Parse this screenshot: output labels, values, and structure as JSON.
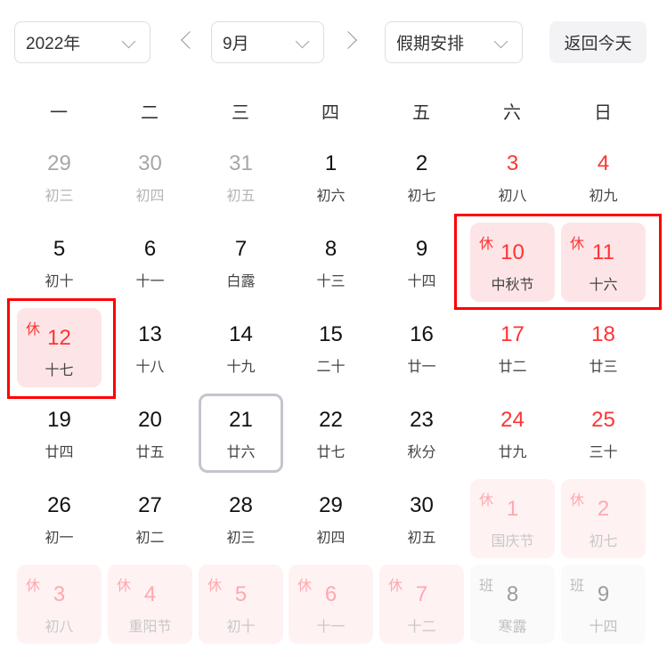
{
  "toolbar": {
    "year_select": "2022年",
    "month_select": "9月",
    "holiday_select": "假期安排",
    "today_button": "返回今天"
  },
  "weekdays": [
    "一",
    "二",
    "三",
    "四",
    "五",
    "六",
    "日"
  ],
  "colors": {
    "accent_red": "#ff3333",
    "rest_bg": "#fde5e7",
    "highlight_outline": "#ff0000",
    "today_border": "#c3c5ce"
  },
  "days": [
    {
      "day": "29",
      "lunar": "初三",
      "type": "other"
    },
    {
      "day": "30",
      "lunar": "初四",
      "type": "other"
    },
    {
      "day": "31",
      "lunar": "初五",
      "type": "other"
    },
    {
      "day": "1",
      "lunar": "初六",
      "type": "normal"
    },
    {
      "day": "2",
      "lunar": "初七",
      "type": "normal"
    },
    {
      "day": "3",
      "lunar": "初八",
      "type": "weekend"
    },
    {
      "day": "4",
      "lunar": "初九",
      "type": "weekend"
    },
    {
      "day": "5",
      "lunar": "初十",
      "type": "normal"
    },
    {
      "day": "6",
      "lunar": "十一",
      "type": "normal"
    },
    {
      "day": "7",
      "lunar": "白露",
      "type": "normal"
    },
    {
      "day": "8",
      "lunar": "十三",
      "type": "normal"
    },
    {
      "day": "9",
      "lunar": "十四",
      "type": "normal"
    },
    {
      "day": "10",
      "lunar": "中秋节",
      "type": "rest",
      "tag": "休"
    },
    {
      "day": "11",
      "lunar": "十六",
      "type": "rest",
      "tag": "休"
    },
    {
      "day": "12",
      "lunar": "十七",
      "type": "rest",
      "tag": "休"
    },
    {
      "day": "13",
      "lunar": "十八",
      "type": "normal"
    },
    {
      "day": "14",
      "lunar": "十九",
      "type": "normal"
    },
    {
      "day": "15",
      "lunar": "二十",
      "type": "normal"
    },
    {
      "day": "16",
      "lunar": "廿一",
      "type": "normal"
    },
    {
      "day": "17",
      "lunar": "廿二",
      "type": "weekend"
    },
    {
      "day": "18",
      "lunar": "廿三",
      "type": "weekend"
    },
    {
      "day": "19",
      "lunar": "廿四",
      "type": "normal"
    },
    {
      "day": "20",
      "lunar": "廿五",
      "type": "normal"
    },
    {
      "day": "21",
      "lunar": "廿六",
      "type": "today"
    },
    {
      "day": "22",
      "lunar": "廿七",
      "type": "normal"
    },
    {
      "day": "23",
      "lunar": "秋分",
      "type": "normal"
    },
    {
      "day": "24",
      "lunar": "廿九",
      "type": "weekend"
    },
    {
      "day": "25",
      "lunar": "三十",
      "type": "weekend"
    },
    {
      "day": "26",
      "lunar": "初一",
      "type": "normal"
    },
    {
      "day": "27",
      "lunar": "初二",
      "type": "normal"
    },
    {
      "day": "28",
      "lunar": "初三",
      "type": "normal"
    },
    {
      "day": "29",
      "lunar": "初四",
      "type": "normal"
    },
    {
      "day": "30",
      "lunar": "初五",
      "type": "normal"
    },
    {
      "day": "1",
      "lunar": "国庆节",
      "type": "rest-other",
      "tag": "休"
    },
    {
      "day": "2",
      "lunar": "初七",
      "type": "rest-other",
      "tag": "休"
    },
    {
      "day": "3",
      "lunar": "初八",
      "type": "rest-other",
      "tag": "休"
    },
    {
      "day": "4",
      "lunar": "重阳节",
      "type": "rest-other",
      "tag": "休"
    },
    {
      "day": "5",
      "lunar": "初十",
      "type": "rest-other",
      "tag": "休"
    },
    {
      "day": "6",
      "lunar": "十一",
      "type": "rest-other",
      "tag": "休"
    },
    {
      "day": "7",
      "lunar": "十二",
      "type": "rest-other",
      "tag": "休"
    },
    {
      "day": "8",
      "lunar": "寒露",
      "type": "work-other",
      "tag": "班"
    },
    {
      "day": "9",
      "lunar": "十四",
      "type": "work-other",
      "tag": "班"
    }
  ]
}
